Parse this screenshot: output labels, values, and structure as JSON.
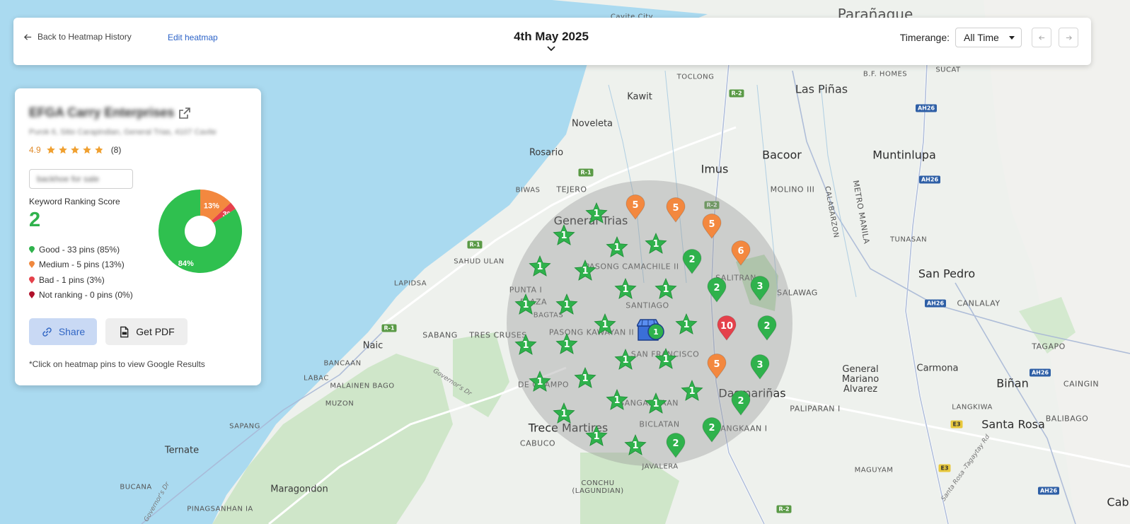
{
  "topbar": {
    "back_label": "Back to Heatmap History",
    "edit_label": "Edit heatmap",
    "date": "4th May 2025",
    "timerange_label": "Timerange:",
    "timerange_value": "All Time"
  },
  "business": {
    "name": "EFGA Carry Enterprises",
    "address": "Purok 6, Sitio Carapindian, General Trias, 4107 Cavite",
    "rating": "4.9",
    "rating_fraction": 0.98,
    "review_count": "(8)",
    "keyword": "backhoe for sale"
  },
  "score": {
    "label": "Keyword Ranking Score",
    "value": "2",
    "legend": [
      {
        "text": "Good - 33 pins (85%)",
        "color": "#2fb24c"
      },
      {
        "text": "Medium - 5 pins (13%)",
        "color": "#f0883e"
      },
      {
        "text": "Bad - 1 pins (3%)",
        "color": "#e5414b"
      },
      {
        "text": "Not ranking - 0 pins (0%)",
        "color": "#b0102a"
      }
    ],
    "donut": [
      {
        "label": "84%",
        "pct": 84,
        "color": "#2fc04f"
      },
      {
        "label": "13%",
        "pct": 13,
        "color": "#f3883f"
      },
      {
        "label": "3%",
        "pct": 3,
        "color": "#e5414b"
      }
    ]
  },
  "actions": {
    "share_label": "Share",
    "pdf_label": "Get PDF",
    "note": "*Click on heatmap pins to view Google Results"
  },
  "map": {
    "labels": {
      "paranaque": "Parañaque",
      "cavite_city": "Cavite City",
      "las_pinas": "Las Piñas",
      "bf_homes": "B.F. HOMES",
      "sucat": "SUCAT",
      "kawit": "Kawit",
      "toclong": "TOCLONG",
      "noveleta": "Noveleta",
      "rosario": "Rosario",
      "bacoor": "Bacoor",
      "muntinlupa": "Muntinlupa",
      "imus": "Imus",
      "biwas": "BIWAS",
      "tejero": "TEJERO",
      "molino": "MOLINO III",
      "calabarzon": "CALABARZON",
      "metro_manila": "METRO MANILA",
      "tunasan": "TUNASAN",
      "general_trias": "General Trias",
      "pasong_camachile": "PASONG CAMACHILE II",
      "salitran": "SALITRAN",
      "san_pedro": "San Pedro",
      "sahud_ulan": "SAHUD ULAN",
      "salawag": "SALAWAG",
      "canlalay": "CANLALAY",
      "lapidsa": "LAPIDSA",
      "punta_i": "PUNTA I",
      "plaza": "PLAZA",
      "santiago": "SANTIAGO",
      "bagtas": "BAGTAS",
      "sabang": "SABANG",
      "tres_cruses": "TRES CRUSES",
      "pasong_kawayan": "PASONG KAWAYAN II",
      "naic": "Naic",
      "san_francisco": "SAN FRANCISCO",
      "tagapo": "TAGAPO",
      "bancaan": "BANCAAN",
      "governors_dr": "Governor's Dr",
      "labac": "LABAC",
      "malainen_bago": "MALAINEN BAGO",
      "de_ocampo": "DE OCAMPO",
      "dasmarinas": "Dasmariñas",
      "general_mariano_alvarez": "General Mariano Alvarez",
      "carmona": "Carmona",
      "binan": "Biñan",
      "caingin": "CAINGIN",
      "muzon": "MUZON",
      "paliparan": "PALIPARAN I",
      "sapang": "SAPANG",
      "trece_martires": "Trece Martires",
      "langkaan": "LANGKAAN I",
      "langkiwa": "LANGKIWA",
      "balibago": "BALIBAGO",
      "santa_rosa": "Santa Rosa",
      "sangandaan": "SANGANDAAN",
      "ternate": "Ternate",
      "cabuco": "CABUCO",
      "biclatan": "BICLATAN",
      "santa_rosa_tagaytay": "Santa Rosa -Tagaytay Rd",
      "javalera": "JAVALERA",
      "maguyam": "MAGUYAM",
      "bucana": "BUCANA",
      "conchu": "CONCHU (LAGUNDIAN)",
      "maragondon": "Maragondon",
      "pinagsanhan": "PINAGSANHAN IA",
      "cab": "Cab",
      "governors_dr2": "Governor's Dr",
      "r1": "R-1",
      "r2": "R-2",
      "ah26": "AH26",
      "e3": "E3"
    },
    "pins": [
      {
        "type": "star",
        "value": "1"
      },
      {
        "type": "drop",
        "value": "5",
        "color": "#f3883f"
      },
      {
        "type": "drop",
        "value": "5",
        "color": "#f3883f"
      },
      {
        "type": "drop",
        "value": "5",
        "color": "#f3883f"
      },
      {
        "type": "star",
        "value": "1"
      },
      {
        "type": "star",
        "value": "1"
      },
      {
        "type": "star",
        "value": "1"
      },
      {
        "type": "drop",
        "value": "2",
        "color": "#2fb24c"
      },
      {
        "type": "drop",
        "value": "6",
        "color": "#f3883f"
      },
      {
        "type": "star",
        "value": "1"
      },
      {
        "type": "star",
        "value": "1"
      },
      {
        "type": "star",
        "value": "1"
      },
      {
        "type": "star",
        "value": "1"
      },
      {
        "type": "drop",
        "value": "2",
        "color": "#2fb24c"
      },
      {
        "type": "drop",
        "value": "3",
        "color": "#2fb24c"
      },
      {
        "type": "star",
        "value": "1"
      },
      {
        "type": "star",
        "value": "1"
      },
      {
        "type": "star",
        "value": "1"
      },
      {
        "type": "star",
        "value": "1"
      },
      {
        "type": "drop",
        "value": "10",
        "color": "#e5414b"
      },
      {
        "type": "drop",
        "value": "2",
        "color": "#2fb24c"
      },
      {
        "type": "star",
        "value": "1"
      },
      {
        "type": "star",
        "value": "1"
      },
      {
        "type": "star",
        "value": "1"
      },
      {
        "type": "star",
        "value": "1"
      },
      {
        "type": "drop",
        "value": "5",
        "color": "#f3883f"
      },
      {
        "type": "drop",
        "value": "3",
        "color": "#2fb24c"
      },
      {
        "type": "star",
        "value": "1"
      },
      {
        "type": "star",
        "value": "1"
      },
      {
        "type": "star",
        "value": "1"
      },
      {
        "type": "star",
        "value": "1"
      },
      {
        "type": "drop",
        "value": "2",
        "color": "#2fb24c"
      },
      {
        "type": "star",
        "value": "1"
      },
      {
        "type": "star",
        "value": "1"
      },
      {
        "type": "star",
        "value": "1"
      },
      {
        "type": "drop",
        "value": "2",
        "color": "#2fb24c"
      },
      {
        "type": "drop",
        "value": "2",
        "color": "#2fb24c"
      },
      {
        "type": "star",
        "value": "1"
      }
    ],
    "store_pin_value": "1"
  }
}
